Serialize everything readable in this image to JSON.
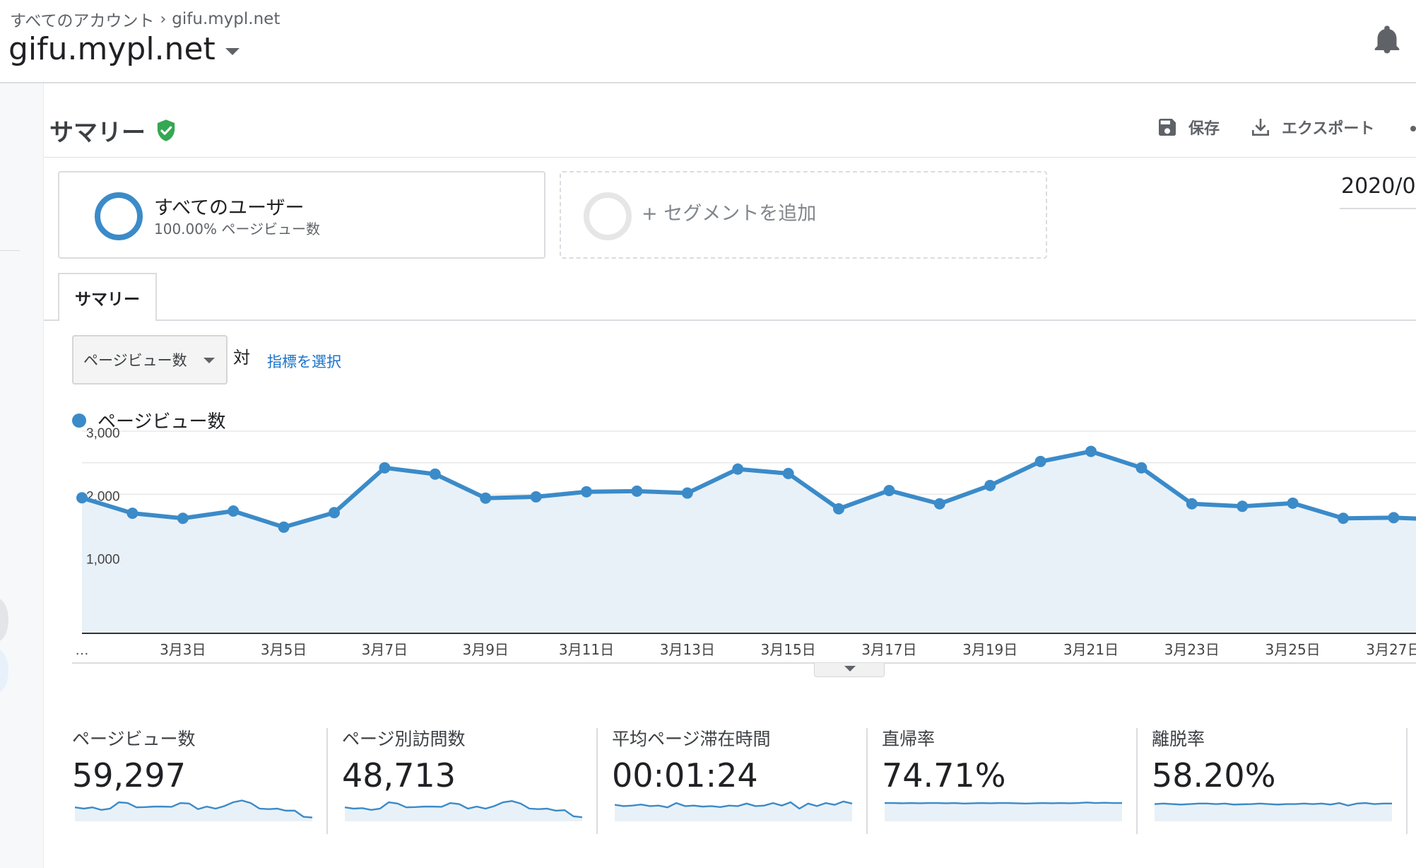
{
  "header": {
    "breadcrumb_root": "すべてのアカウント",
    "breadcrumb_property": "gifu.mypl.net",
    "property_name": "gifu.mypl.net"
  },
  "page": {
    "title": "サマリー",
    "save_label": "保存",
    "export_label": "エクスポート",
    "date_range": "2020/0"
  },
  "segments": {
    "active": {
      "name": "すべてのユーザー",
      "detail": "100.00% ページビュー数"
    },
    "add_label": "+ セグメントを追加"
  },
  "tab": {
    "label": "サマリー"
  },
  "metric_picker": {
    "selected": "ページビュー数",
    "versus": "対",
    "choose_label": "指標を選択"
  },
  "legend": {
    "series_label": "ページビュー数"
  },
  "colors": {
    "series": "#3b8bc9",
    "area": "#e9f1f8",
    "link": "#1a73c9",
    "shield": "#34a853"
  },
  "icons": [
    "bell-icon",
    "shield-check-icon",
    "save-icon",
    "download-icon",
    "chevron-right-icon",
    "dropdown-arrow-icon"
  ],
  "chart_data": {
    "type": "area",
    "series_name": "ページビュー数",
    "x_label_first": "…",
    "x": [
      "3月1日",
      "3月2日",
      "3月3日",
      "3月4日",
      "3月5日",
      "3月6日",
      "3月7日",
      "3月8日",
      "3月9日",
      "3月10日",
      "3月11日",
      "3月12日",
      "3月13日",
      "3月14日",
      "3月15日",
      "3月16日",
      "3月17日",
      "3月18日",
      "3月19日",
      "3月20日",
      "3月21日",
      "3月22日",
      "3月23日",
      "3月24日",
      "3月25日",
      "3月26日",
      "3月27日",
      "3月28日"
    ],
    "values": [
      1945,
      1700,
      1620,
      1735,
      1480,
      1710,
      2420,
      2320,
      1940,
      1960,
      2040,
      2050,
      2020,
      2400,
      2330,
      1770,
      2060,
      1850,
      2140,
      2520,
      2680,
      2420,
      1850,
      1810,
      1860,
      1620,
      1630,
      1600
    ],
    "xticks": [
      "3月3日",
      "3月5日",
      "3月7日",
      "3月9日",
      "3月11日",
      "3月13日",
      "3月15日",
      "3月17日",
      "3月19日",
      "3月21日",
      "3月23日",
      "3月25日",
      "3月27日"
    ],
    "yticks": [
      1000,
      2000,
      3000
    ],
    "ytick_labels": [
      "1,000",
      "2,000",
      "3,000"
    ],
    "ylim": [
      0,
      3000
    ],
    "grid": true
  },
  "scorecards": [
    {
      "label": "ページビュー数",
      "value": "59,297",
      "spark": [
        0.55,
        0.5,
        0.55,
        0.45,
        0.5,
        0.75,
        0.72,
        0.55,
        0.56,
        0.58,
        0.58,
        0.57,
        0.72,
        0.7,
        0.48,
        0.58,
        0.5,
        0.6,
        0.75,
        0.82,
        0.72,
        0.5,
        0.48,
        0.5,
        0.42,
        0.42,
        0.18,
        0.15
      ]
    },
    {
      "label": "ページ別訪問数",
      "value": "48,713",
      "spark": [
        0.55,
        0.5,
        0.52,
        0.45,
        0.5,
        0.75,
        0.7,
        0.55,
        0.56,
        0.58,
        0.58,
        0.57,
        0.72,
        0.68,
        0.5,
        0.58,
        0.5,
        0.6,
        0.75,
        0.8,
        0.7,
        0.5,
        0.48,
        0.5,
        0.42,
        0.44,
        0.2,
        0.16
      ]
    },
    {
      "label": "平均ページ滞在時間",
      "value": "00:01:24",
      "spark": [
        0.65,
        0.6,
        0.62,
        0.66,
        0.6,
        0.62,
        0.55,
        0.72,
        0.6,
        0.62,
        0.58,
        0.6,
        0.56,
        0.62,
        0.6,
        0.7,
        0.6,
        0.62,
        0.72,
        0.62,
        0.75,
        0.5,
        0.7,
        0.6,
        0.72,
        0.65,
        0.78,
        0.7
      ]
    },
    {
      "label": "直帰率",
      "value": "74.71%",
      "spark": [
        0.72,
        0.72,
        0.71,
        0.72,
        0.71,
        0.72,
        0.72,
        0.71,
        0.72,
        0.7,
        0.71,
        0.72,
        0.71,
        0.72,
        0.72,
        0.71,
        0.7,
        0.71,
        0.72,
        0.71,
        0.72,
        0.71,
        0.72,
        0.74,
        0.72,
        0.73,
        0.72,
        0.72
      ]
    },
    {
      "label": "離脱率",
      "value": "58.20%",
      "spark": [
        0.68,
        0.7,
        0.68,
        0.66,
        0.68,
        0.7,
        0.7,
        0.68,
        0.7,
        0.66,
        0.67,
        0.68,
        0.7,
        0.68,
        0.66,
        0.68,
        0.68,
        0.7,
        0.68,
        0.7,
        0.66,
        0.72,
        0.62,
        0.7,
        0.72,
        0.68,
        0.7,
        0.7
      ]
    }
  ]
}
